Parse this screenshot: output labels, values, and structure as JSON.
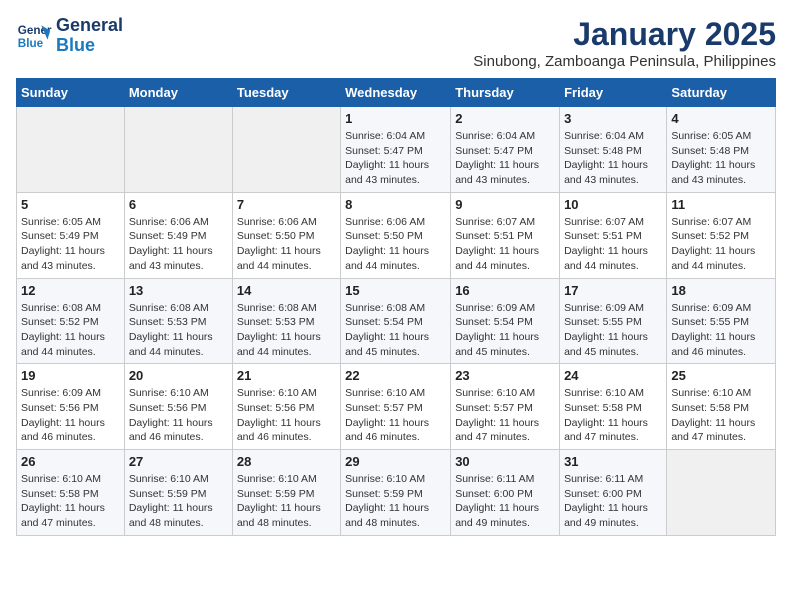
{
  "header": {
    "logo_line1": "General",
    "logo_line2": "Blue",
    "title": "January 2025",
    "subtitle": "Sinubong, Zamboanga Peninsula, Philippines"
  },
  "days_of_week": [
    "Sunday",
    "Monday",
    "Tuesday",
    "Wednesday",
    "Thursday",
    "Friday",
    "Saturday"
  ],
  "weeks": [
    [
      {
        "num": "",
        "info": ""
      },
      {
        "num": "",
        "info": ""
      },
      {
        "num": "",
        "info": ""
      },
      {
        "num": "1",
        "info": "Sunrise: 6:04 AM\nSunset: 5:47 PM\nDaylight: 11 hours and 43 minutes."
      },
      {
        "num": "2",
        "info": "Sunrise: 6:04 AM\nSunset: 5:47 PM\nDaylight: 11 hours and 43 minutes."
      },
      {
        "num": "3",
        "info": "Sunrise: 6:04 AM\nSunset: 5:48 PM\nDaylight: 11 hours and 43 minutes."
      },
      {
        "num": "4",
        "info": "Sunrise: 6:05 AM\nSunset: 5:48 PM\nDaylight: 11 hours and 43 minutes."
      }
    ],
    [
      {
        "num": "5",
        "info": "Sunrise: 6:05 AM\nSunset: 5:49 PM\nDaylight: 11 hours and 43 minutes."
      },
      {
        "num": "6",
        "info": "Sunrise: 6:06 AM\nSunset: 5:49 PM\nDaylight: 11 hours and 43 minutes."
      },
      {
        "num": "7",
        "info": "Sunrise: 6:06 AM\nSunset: 5:50 PM\nDaylight: 11 hours and 44 minutes."
      },
      {
        "num": "8",
        "info": "Sunrise: 6:06 AM\nSunset: 5:50 PM\nDaylight: 11 hours and 44 minutes."
      },
      {
        "num": "9",
        "info": "Sunrise: 6:07 AM\nSunset: 5:51 PM\nDaylight: 11 hours and 44 minutes."
      },
      {
        "num": "10",
        "info": "Sunrise: 6:07 AM\nSunset: 5:51 PM\nDaylight: 11 hours and 44 minutes."
      },
      {
        "num": "11",
        "info": "Sunrise: 6:07 AM\nSunset: 5:52 PM\nDaylight: 11 hours and 44 minutes."
      }
    ],
    [
      {
        "num": "12",
        "info": "Sunrise: 6:08 AM\nSunset: 5:52 PM\nDaylight: 11 hours and 44 minutes."
      },
      {
        "num": "13",
        "info": "Sunrise: 6:08 AM\nSunset: 5:53 PM\nDaylight: 11 hours and 44 minutes."
      },
      {
        "num": "14",
        "info": "Sunrise: 6:08 AM\nSunset: 5:53 PM\nDaylight: 11 hours and 44 minutes."
      },
      {
        "num": "15",
        "info": "Sunrise: 6:08 AM\nSunset: 5:54 PM\nDaylight: 11 hours and 45 minutes."
      },
      {
        "num": "16",
        "info": "Sunrise: 6:09 AM\nSunset: 5:54 PM\nDaylight: 11 hours and 45 minutes."
      },
      {
        "num": "17",
        "info": "Sunrise: 6:09 AM\nSunset: 5:55 PM\nDaylight: 11 hours and 45 minutes."
      },
      {
        "num": "18",
        "info": "Sunrise: 6:09 AM\nSunset: 5:55 PM\nDaylight: 11 hours and 46 minutes."
      }
    ],
    [
      {
        "num": "19",
        "info": "Sunrise: 6:09 AM\nSunset: 5:56 PM\nDaylight: 11 hours and 46 minutes."
      },
      {
        "num": "20",
        "info": "Sunrise: 6:10 AM\nSunset: 5:56 PM\nDaylight: 11 hours and 46 minutes."
      },
      {
        "num": "21",
        "info": "Sunrise: 6:10 AM\nSunset: 5:56 PM\nDaylight: 11 hours and 46 minutes."
      },
      {
        "num": "22",
        "info": "Sunrise: 6:10 AM\nSunset: 5:57 PM\nDaylight: 11 hours and 46 minutes."
      },
      {
        "num": "23",
        "info": "Sunrise: 6:10 AM\nSunset: 5:57 PM\nDaylight: 11 hours and 47 minutes."
      },
      {
        "num": "24",
        "info": "Sunrise: 6:10 AM\nSunset: 5:58 PM\nDaylight: 11 hours and 47 minutes."
      },
      {
        "num": "25",
        "info": "Sunrise: 6:10 AM\nSunset: 5:58 PM\nDaylight: 11 hours and 47 minutes."
      }
    ],
    [
      {
        "num": "26",
        "info": "Sunrise: 6:10 AM\nSunset: 5:58 PM\nDaylight: 11 hours and 47 minutes."
      },
      {
        "num": "27",
        "info": "Sunrise: 6:10 AM\nSunset: 5:59 PM\nDaylight: 11 hours and 48 minutes."
      },
      {
        "num": "28",
        "info": "Sunrise: 6:10 AM\nSunset: 5:59 PM\nDaylight: 11 hours and 48 minutes."
      },
      {
        "num": "29",
        "info": "Sunrise: 6:10 AM\nSunset: 5:59 PM\nDaylight: 11 hours and 48 minutes."
      },
      {
        "num": "30",
        "info": "Sunrise: 6:11 AM\nSunset: 6:00 PM\nDaylight: 11 hours and 49 minutes."
      },
      {
        "num": "31",
        "info": "Sunrise: 6:11 AM\nSunset: 6:00 PM\nDaylight: 11 hours and 49 minutes."
      },
      {
        "num": "",
        "info": ""
      }
    ]
  ]
}
